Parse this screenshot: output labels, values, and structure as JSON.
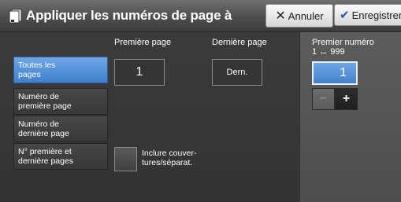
{
  "header": {
    "title": "Appliquer les numéros de page à",
    "icon": "page-number-icon",
    "cancel_label": "Annuler",
    "cancel_icon": "close-icon",
    "save_label": "Enregistrer",
    "save_icon": "check-icon"
  },
  "options": {
    "items": [
      {
        "label": "Toutes les pages",
        "line1": "Toutes les",
        "line2": "pages",
        "selected": true
      },
      {
        "label": "Numéro de première page",
        "line1": "Numéro de",
        "line2": "première page",
        "selected": false
      },
      {
        "label": "Numéro de dernière page",
        "line1": "Numéro de",
        "line2": "dernière page",
        "selected": false
      },
      {
        "label": "N° première et dernière pages",
        "line1": "N° première et",
        "line2": "dernière pages",
        "selected": false
      }
    ]
  },
  "first_page": {
    "label": "Première page",
    "value": "1"
  },
  "last_page": {
    "label": "Dernière page",
    "value": "Dern."
  },
  "include_covers": {
    "line1": "Inclure couver-",
    "line2": "tures/séparat.",
    "checked": false
  },
  "start_number": {
    "label": "Premier numéro",
    "range": "1 ↔ 999",
    "value": "1",
    "minus_label": "−",
    "plus_label": "+"
  },
  "colors": {
    "selected": "#4a88d6",
    "background": "#3a3a3a"
  }
}
